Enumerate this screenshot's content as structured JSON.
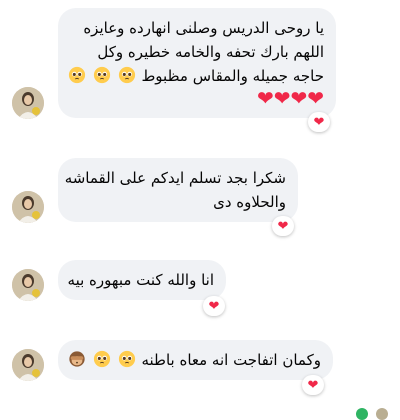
{
  "messages": [
    {
      "lines": [
        "يا روحى الدريس وصلنى انهارده وعايزه",
        "اللهم بارك تحفه والخامه خطيره وكل",
        "حاجه جميله والمقاس مظبوط"
      ],
      "line3_emoji": [
        "pleading-face",
        "pleading-face",
        "pleading-face"
      ],
      "hearts_line": [
        "red-heart",
        "red-heart",
        "red-heart",
        "red-heart"
      ],
      "reaction": "red-heart"
    },
    {
      "lines": [
        "شكرا بجد تسلم ايدكم على القماشه",
        "والحلاوه دى"
      ],
      "reaction": "red-heart"
    },
    {
      "lines": [
        "انا والله كنت مبهوره بيه"
      ],
      "reaction": "red-heart"
    },
    {
      "lines": [
        "وكمان اتفاجت انه معاه باطنه"
      ],
      "line_emoji": [
        "pleading-face",
        "pleading-face",
        "see-no-evil-monkey"
      ],
      "reaction": "red-heart"
    }
  ],
  "colors": {
    "bubble_bg": "#f0f2f5",
    "text": "#050505",
    "heart": "#f02849",
    "emoji_face": "#ffcc4d"
  },
  "icons": [
    "avatar-photo",
    "pleading-face",
    "red-heart",
    "see-no-evil-monkey",
    "seen-indicator"
  ]
}
